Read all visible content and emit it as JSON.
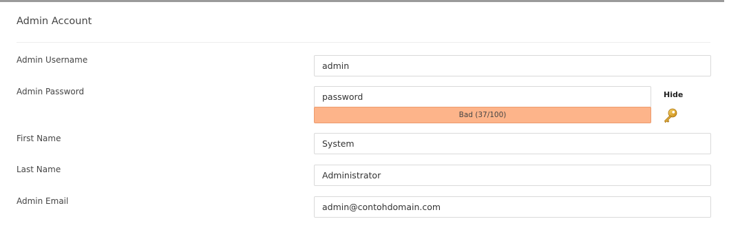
{
  "panel": {
    "title": "Admin Account"
  },
  "fields": {
    "username": {
      "label": "Admin Username",
      "value": "admin"
    },
    "password": {
      "label": "Admin Password",
      "value": "password",
      "toggle_label": "Hide",
      "strength_text": "Bad (37/100)",
      "strength_score": 37,
      "strength_color": "#fdb48a",
      "generate_icon": "key-icon"
    },
    "first_name": {
      "label": "First Name",
      "value": "System"
    },
    "last_name": {
      "label": "Last Name",
      "value": "Administrator"
    },
    "email": {
      "label": "Admin Email",
      "value": "admin@contohdomain.com"
    }
  }
}
